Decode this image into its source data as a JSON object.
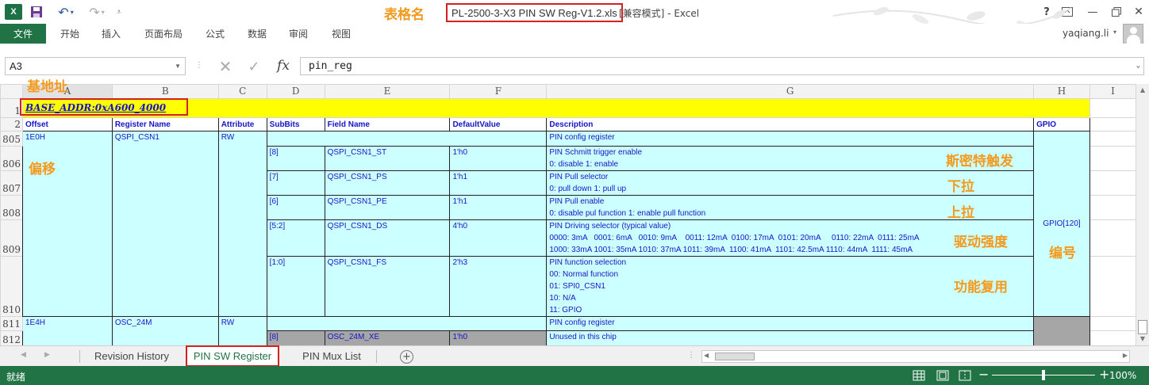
{
  "titlebar": {
    "file_name": "PL-2500-3-X3 PIN SW Reg-V1.2.xls",
    "mode_suffix": "[兼容模式] - Excel",
    "logo_letter": "X",
    "help": "?"
  },
  "ribbon": {
    "tabs": [
      "文件",
      "开始",
      "插入",
      "页面布局",
      "公式",
      "数据",
      "审阅",
      "视图"
    ],
    "user": "yaqiang.li"
  },
  "formula_bar": {
    "name_box": "A3",
    "fx": "fx",
    "formula": "pin_reg"
  },
  "columns": [
    "A",
    "B",
    "C",
    "D",
    "E",
    "F",
    "G",
    "H",
    "I"
  ],
  "sheet": {
    "base_addr": "BASE_ADDR:0xA600_4000",
    "headers": [
      "Offset",
      "Register Name",
      "Attribute",
      "SubBits",
      "Field Name",
      "DefaultValue",
      "Description",
      "GPIO"
    ],
    "row_numbers": [
      "1",
      "2",
      "805",
      "806",
      "807",
      "808",
      "809",
      "810",
      "811",
      "812"
    ],
    "reg1": {
      "offset": "1E0H",
      "name": "QSPI_CSN1",
      "attr": "RW",
      "config_desc": "PIN config register",
      "gpio": "GPIO[120]",
      "fields": [
        {
          "bits": "[8]",
          "name": "QSPI_CSN1_ST",
          "default": "1'h0",
          "desc": [
            "PIN Schmitt trigger enable",
            "0: disable 1: enable"
          ]
        },
        {
          "bits": "[7]",
          "name": "QSPI_CSN1_PS",
          "default": "1'h1",
          "desc": [
            "PIN Pull selector",
            "0: pull down 1: pull up"
          ]
        },
        {
          "bits": "[6]",
          "name": "QSPI_CSN1_PE",
          "default": "1'h1",
          "desc": [
            "PIN Pull enable",
            "0: disable pul function 1: enable pull function"
          ]
        },
        {
          "bits": "[5:2]",
          "name": "QSPI_CSN1_DS",
          "default": "4'h0",
          "desc": [
            "PIN Driving selector (typical value)",
            "0000: 3mA   0001: 6mA   0010: 9mA    0011: 12mA  0100: 17mA  0101: 20mA     0110: 22mA  0111: 25mA",
            "1000: 33mA 1001: 35mA 1010: 37mA 1011: 39mA  1100: 41mA  1101: 42.5mA 1110: 44mA  1111: 45mA"
          ]
        },
        {
          "bits": "[1:0]",
          "name": "QSPI_CSN1_FS",
          "default": "2'h3",
          "desc": [
            "PIN function selection",
            "00: Normal function",
            "01: SPI0_CSN1",
            "10: N/A",
            "11: GPIO"
          ]
        }
      ]
    },
    "reg2": {
      "offset": "1E4H",
      "name": "OSC_24M",
      "attr": "RW",
      "config_desc": "PIN config register",
      "field": {
        "bits": "[8]",
        "name": "OSC_24M_XE",
        "default": "1'h0",
        "desc": "Unused in this chip"
      }
    }
  },
  "annotations": {
    "sheet_name": "表格名",
    "base_addr": "基地址",
    "offset": "偏移",
    "schmitt": "斯密特触发",
    "pull_down": "下拉",
    "pull_up": "上拉",
    "drive": "驱动强度",
    "number": "编号",
    "mux": "功能复用"
  },
  "sheet_tabs": [
    "Revision History",
    "PIN SW Register",
    "PIN Mux List"
  ],
  "active_tab": "PIN SW Register",
  "status": {
    "text": "就绪",
    "zoom": "100%"
  },
  "colors": {
    "excel_green": "#217346",
    "annotation_orange": "#f39a1e",
    "highlight_red": "#d32020",
    "cell_cyan": "#ccffff",
    "cell_yellow": "#ffff00",
    "cell_text_blue": "#1515c7"
  }
}
